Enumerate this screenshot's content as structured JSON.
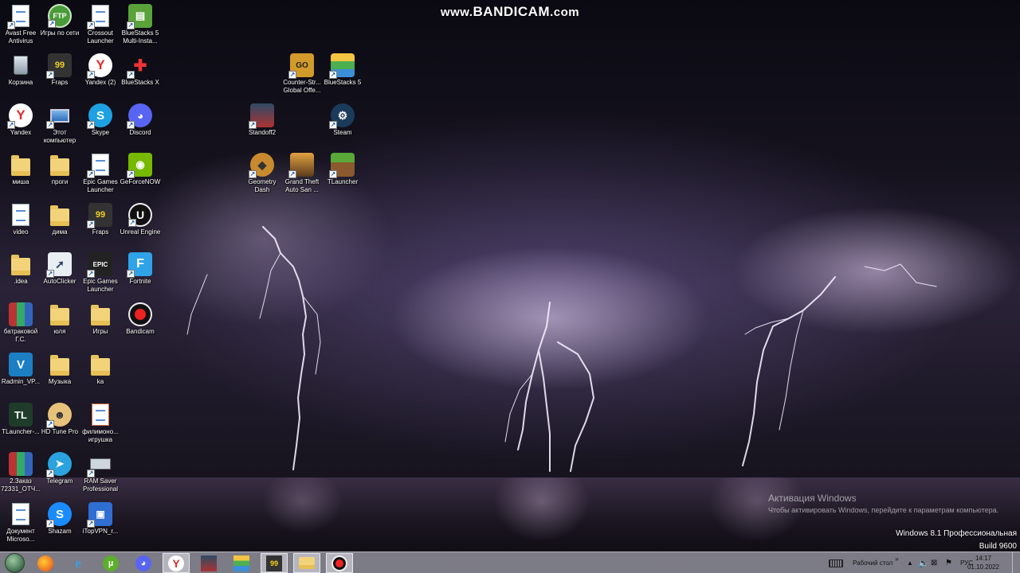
{
  "watermark": {
    "prefix": "www.",
    "brand": "BANDICAM",
    "suffix": ".com"
  },
  "desktop_icons": [
    {
      "label": "Avast Free Antivirus"
    },
    {
      "label": "Игры по сети"
    },
    {
      "label": "Crossout Launcher"
    },
    {
      "label": "BlueStacks 5 Multi-Insta..."
    },
    {
      "label": "Корзина"
    },
    {
      "label": "Fraps"
    },
    {
      "label": "Yandex (2)"
    },
    {
      "label": "BlueStacks X"
    },
    {
      "label": "Counter-Str... Global Offe..."
    },
    {
      "label": "BlueStacks 5"
    },
    {
      "label": "Yandex"
    },
    {
      "label": "Этот компьютер"
    },
    {
      "label": "Skype"
    },
    {
      "label": "Discord"
    },
    {
      "label": "Standoff2"
    },
    {
      "label": "Steam"
    },
    {
      "label": "миша"
    },
    {
      "label": "проги"
    },
    {
      "label": "Epic Games Launcher"
    },
    {
      "label": "GeForceNOW"
    },
    {
      "label": "Geometry Dash"
    },
    {
      "label": "Grand Theft Auto San ..."
    },
    {
      "label": "TLauncher"
    },
    {
      "label": "video"
    },
    {
      "label": "дима"
    },
    {
      "label": "Fraps"
    },
    {
      "label": "Unreal Engine"
    },
    {
      "label": ".idea"
    },
    {
      "label": "AutoClicker"
    },
    {
      "label": "Epic Games Launcher"
    },
    {
      "label": "Fortnite"
    },
    {
      "label": "батраковой Г.С."
    },
    {
      "label": "юля"
    },
    {
      "label": "Игры"
    },
    {
      "label": "Bandicam"
    },
    {
      "label": "Radmin_VP..."
    },
    {
      "label": "Музыка"
    },
    {
      "label": "ka"
    },
    {
      "label": "TLauncher-..."
    },
    {
      "label": "HD Tune Pro"
    },
    {
      "label": "филимоно... игрушка"
    },
    {
      "label": "2.Заказ 72331_ОТЧ..."
    },
    {
      "label": "Telegram"
    },
    {
      "label": "RAM Saver Professional"
    },
    {
      "label": "Документ Microso..."
    },
    {
      "label": "Shazam"
    },
    {
      "label": "iTopVPN_r..."
    }
  ],
  "activation": {
    "title": "Активация Windows",
    "message": "Чтобы активировать Windows, перейдите к параметрам компьютера."
  },
  "windows_version": {
    "edition": "Windows 8.1 Профессиональная",
    "build": "Build 9600"
  },
  "taskbar": {
    "pinned": [
      {
        "name": "Yandex Browser"
      },
      {
        "name": "Internet Explorer"
      },
      {
        "name": "uTorrent"
      },
      {
        "name": "Discord"
      },
      {
        "name": "Yandex"
      },
      {
        "name": "Standoff2"
      },
      {
        "name": "BlueStacks"
      },
      {
        "name": "Fraps"
      },
      {
        "name": "File Explorer"
      },
      {
        "name": "Bandicam"
      }
    ],
    "tray": {
      "desktop_toolbar": "Рабочий стол",
      "desktop_toolbar_arrow": "»",
      "language": "РУС",
      "time": "14:17",
      "date": "01.10.2022"
    }
  }
}
